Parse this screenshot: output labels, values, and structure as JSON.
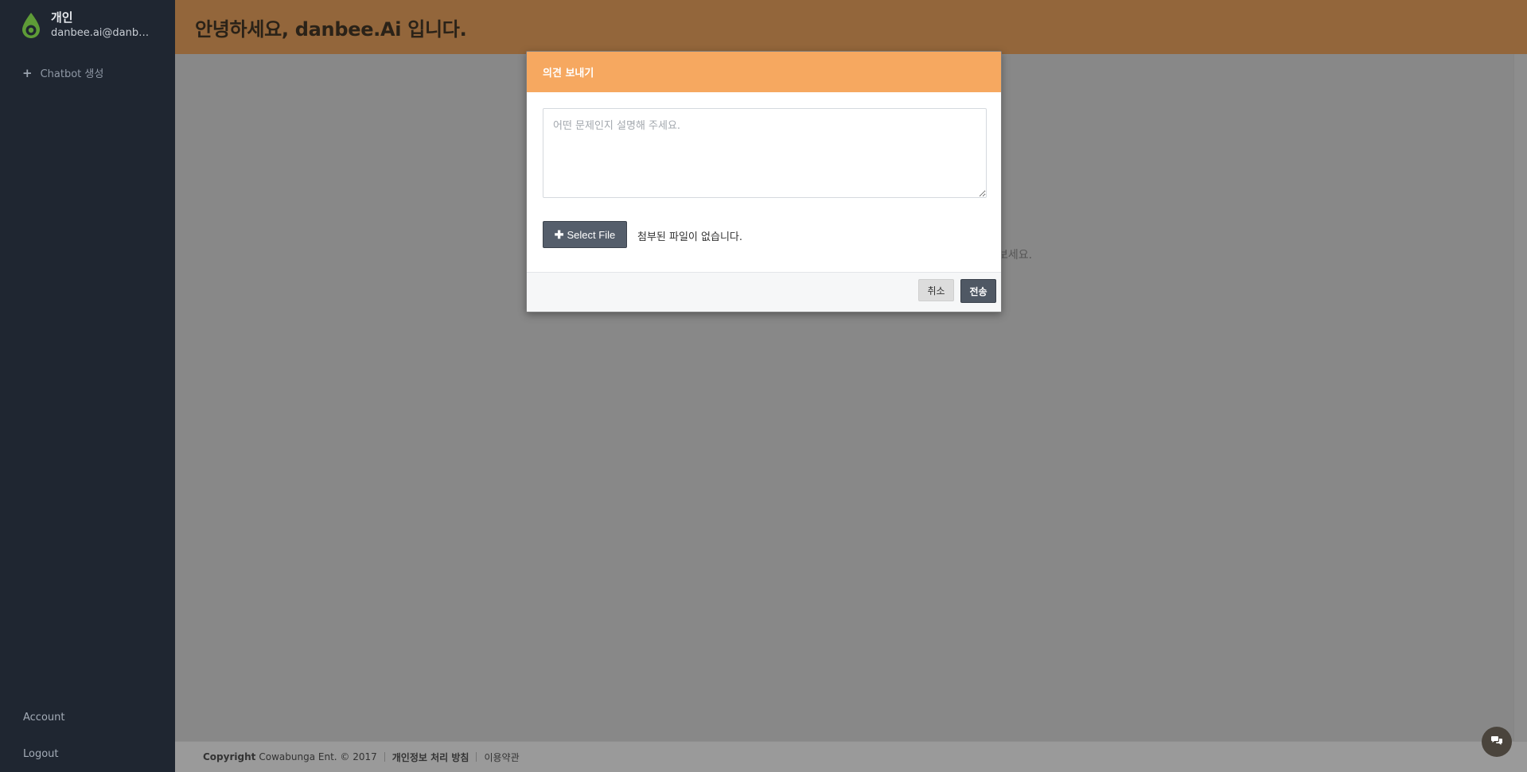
{
  "sidebar": {
    "profile_name": "개인",
    "profile_email": "danbee.ai@danbee...",
    "create_label": "Chatbot 생성",
    "account_label": "Account",
    "logout_label": "Logout"
  },
  "header": {
    "title": "안녕하세요, danbee.Ai 입니다."
  },
  "background": {
    "hint_fragment": "보세요."
  },
  "modal": {
    "title": "의견 보내기",
    "textarea_placeholder": "어떤 문제인지 설명해 주세요.",
    "textarea_value": "",
    "file_button_label": "Select File",
    "file_status": "첨부된 파일이 없습니다.",
    "cancel_label": "취소",
    "send_label": "전송"
  },
  "footer": {
    "copyright_label": "Copyright",
    "company": "Cowabunga Ent. © 2017",
    "privacy_label": "개인정보 처리 방침",
    "terms_label": "이용약관"
  },
  "colors": {
    "sidebar_bg": "#1f2631",
    "header_bg": "#93663b",
    "modal_header_bg": "#f6a860",
    "primary_button": "#555e6b",
    "overlay_bg": "#888888"
  },
  "icons": {
    "logo": "water-drop-logo-icon",
    "create": "plus-icon",
    "file_button": "plus-icon",
    "chat": "chat-bubbles-icon"
  }
}
